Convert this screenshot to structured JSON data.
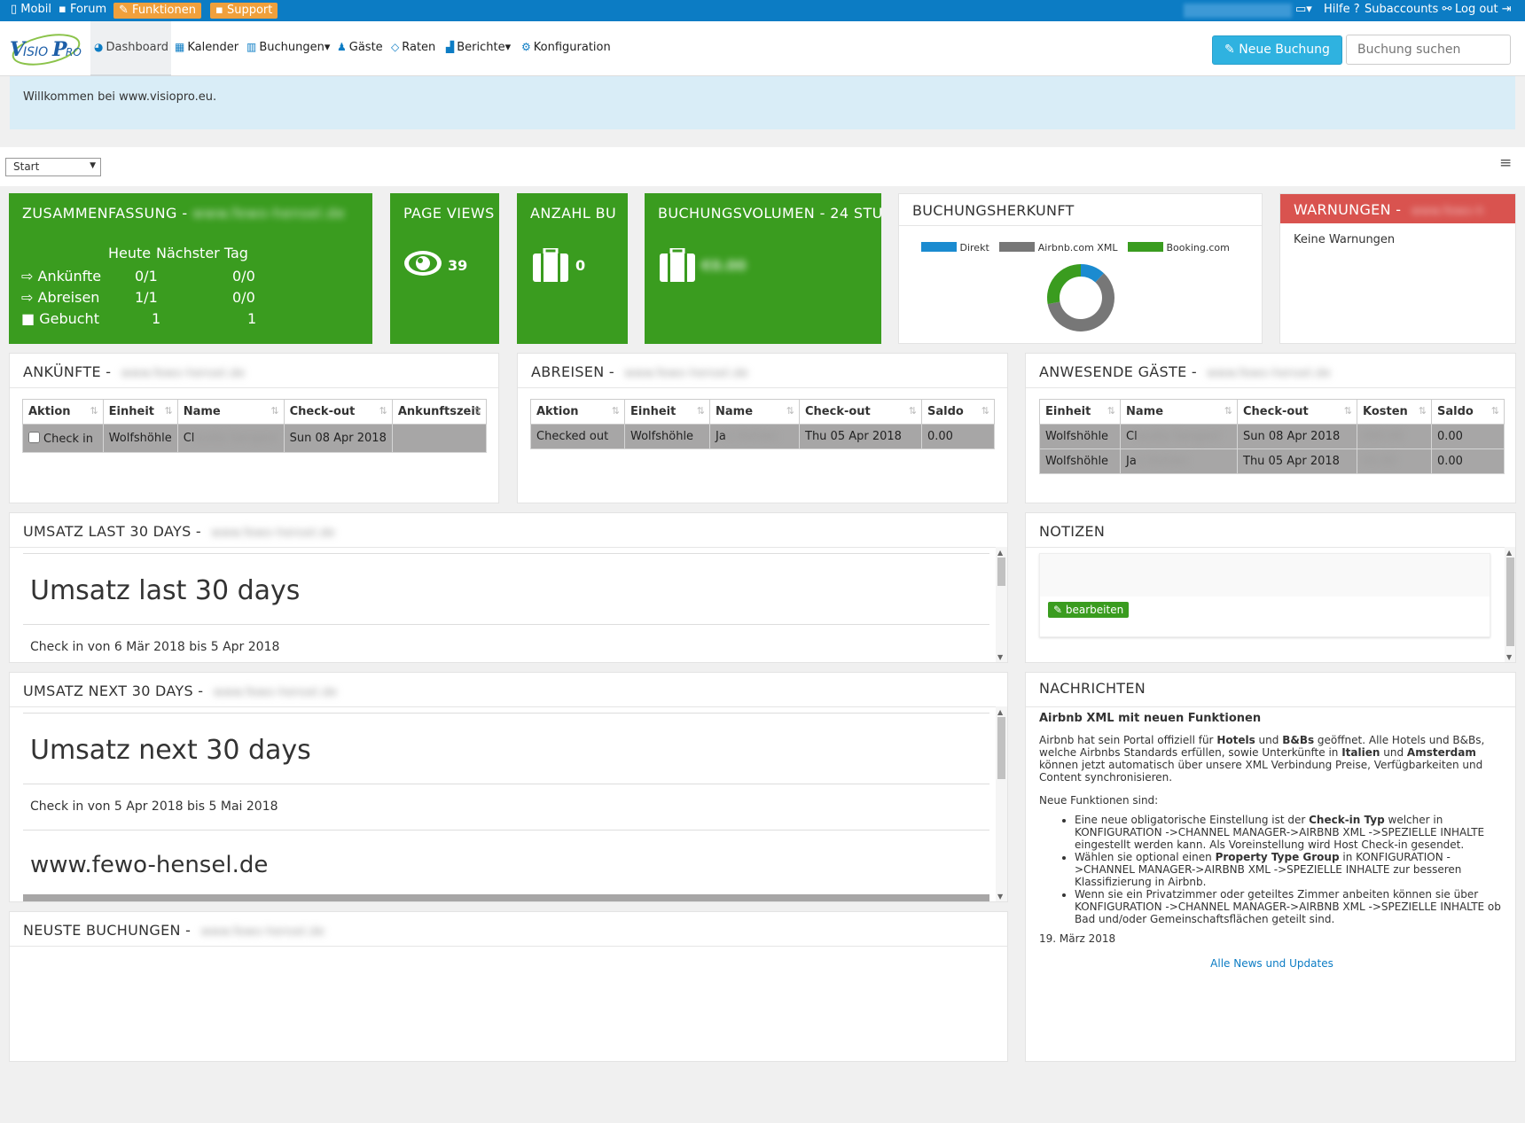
{
  "topbar": {
    "mobil": "Mobil",
    "forum": "Forum",
    "funktionen": "Funktionen",
    "support": "Support",
    "hilfe": "Hilfe ?",
    "subaccounts": "Subaccounts",
    "logout": "Log out"
  },
  "nav": {
    "logo_text": "VisioPro",
    "items": [
      "Dashboard",
      "Kalender",
      "Buchungen",
      "Gäste",
      "Raten",
      "Berichte",
      "Konfiguration"
    ],
    "new_booking": "Neue Buchung",
    "search_placeholder": "Buchung suchen"
  },
  "welcome": "Willkommen bei www.visiopro.eu.",
  "view_select": "Start",
  "tiles": {
    "summary": {
      "title": "ZUSAMMENFASSUNG -",
      "col_today": "Heute",
      "col_next": "Nächster Tag",
      "rows": [
        {
          "label": "Ankünfte",
          "today": "0/1",
          "next": "0/0"
        },
        {
          "label": "Abreisen",
          "today": "1/1",
          "next": "0/0"
        },
        {
          "label": "Gebucht",
          "today": "1",
          "next": "1"
        }
      ]
    },
    "pageviews": {
      "title": "PAGE VIEWS",
      "value": "39"
    },
    "count": {
      "title": "ANZAHL BU",
      "value": "0"
    },
    "volume": {
      "title": "BUCHUNGSVOLUMEN - 24 STU"
    }
  },
  "herkunft": {
    "title": "BUCHUNGSHERKUNFT",
    "legend": [
      {
        "name": "Direkt",
        "color": "#1b8bd0"
      },
      {
        "name": "Airbnb.com XML",
        "color": "#777777"
      },
      {
        "name": "Booking.com",
        "color": "#3a9c1f"
      }
    ]
  },
  "chart_data": {
    "type": "pie",
    "categories": [
      "Direkt",
      "Airbnb.com XML",
      "Booking.com"
    ],
    "values": [
      12,
      60,
      28
    ]
  },
  "warnungen": {
    "title": "WARNUNGEN -",
    "text": "Keine Warnungen"
  },
  "ankuenfte": {
    "title": "ANKÜNFTE -",
    "headers": [
      "Aktion",
      "Einheit",
      "Name",
      "Check-out",
      "Ankunftszeit"
    ],
    "rows": [
      {
        "aktion": "Check in",
        "einheit": "Wolfshöhle",
        "name": "Cl",
        "checkout": "Sun 08 Apr 2018",
        "zeit": ""
      }
    ]
  },
  "abreisen": {
    "title": "ABREISEN -",
    "headers": [
      "Aktion",
      "Einheit",
      "Name",
      "Check-out",
      "Saldo"
    ],
    "rows": [
      {
        "aktion": "Checked out",
        "einheit": "Wolfshöhle",
        "name": "Ja",
        "checkout": "Thu 05 Apr 2018",
        "saldo": "0.00"
      }
    ]
  },
  "anwesend": {
    "title": "ANWESENDE GÄSTE -",
    "headers": [
      "Einheit",
      "Name",
      "Check-out",
      "Kosten",
      "Saldo"
    ],
    "rows": [
      {
        "einheit": "Wolfshöhle",
        "name": "Cl",
        "checkout": "Sun 08 Apr 2018",
        "saldo": "0.00"
      },
      {
        "einheit": "Wolfshöhle",
        "name": "Ja",
        "checkout": "Thu 05 Apr 2018",
        "saldo": "0.00"
      }
    ]
  },
  "umsatz_last": {
    "title": "UMSATZ LAST 30 DAYS -",
    "heading": "Umsatz last 30 days",
    "range": "Check in von 6 Mär 2018 bis 5 Apr 2018"
  },
  "umsatz_next": {
    "title": "UMSATZ NEXT 30 DAYS -",
    "heading": "Umsatz next 30 days",
    "range": "Check in von 5 Apr 2018 bis 5 Mai 2018",
    "site": "www.fewo-hensel.de"
  },
  "notizen": {
    "title": "NOTIZEN",
    "edit": "bearbeiten"
  },
  "neuste": {
    "title": "NEUSTE BUCHUNGEN -"
  },
  "nachrichten": {
    "title": "NACHRICHTEN",
    "headline": "Airbnb XML mit neuen Funktionen",
    "p1_a": "Airbnb hat sein Portal offiziell für ",
    "p1_b": "Hotels",
    "p1_c": " und ",
    "p1_d": "B&Bs",
    "p1_e": " geöffnet. Alle Hotels und B&Bs, welche Airbnbs Standards erfüllen, sowie Unterkünfte in ",
    "p1_f": "Italien",
    "p1_g": " und ",
    "p1_h": "Amsterdam",
    "p1_i": " können jetzt automatisch über unsere XML Verbindung Preise, Verfügbarkeiten und Content synchronisieren.",
    "p2": "Neue Funktionen sind:",
    "li1_a": "Eine neue obligatorische Einstellung ist der ",
    "li1_b": "Check-in Typ",
    "li1_c": " welcher in KONFIGURATION ->CHANNEL MANAGER->AIRBNB XML ->SPEZIELLE INHALTE eingestellt werden kann. Als Voreinstellung wird Host Check-in gesendet.",
    "li2_a": "Wählen sie optional einen ",
    "li2_b": "Property Type Group",
    "li2_c": " in KONFIGURATION ->CHANNEL MANAGER->AIRBNB XML ->SPEZIELLE INHALTE zur besseren Klassifizierung in Airbnb.",
    "li3": "Wenn sie ein Privatzimmer oder geteiltes Zimmer anbeiten können sie über KONFIGURATION ->CHANNEL MANAGER->AIRBNB XML ->SPEZIELLE INHALTE ob Bad und/oder Gemeinschaftsflächen geteilt sind.",
    "date": "19. März 2018",
    "link": "Alle News und Updates"
  }
}
